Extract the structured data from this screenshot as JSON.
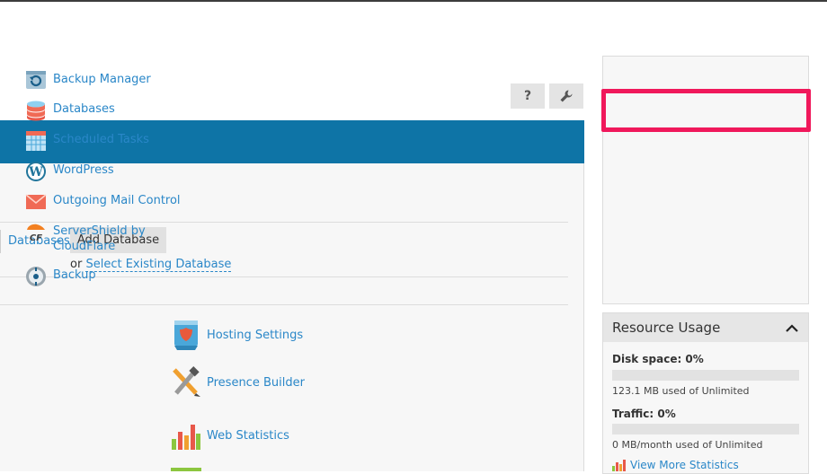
{
  "header": {
    "help_label": "?",
    "help_icon": "question-icon",
    "settings_icon": "wrench-icon"
  },
  "main": {
    "databases_link": "Databases",
    "add_database_button": "Add Database",
    "or_text": "or",
    "select_existing_link": "Select Existing Database",
    "tools": [
      {
        "label": "Hosting Settings",
        "icon": "hosting-settings-icon"
      },
      {
        "label": "Presence Builder",
        "icon": "presence-builder-icon"
      },
      {
        "label": "Web Statistics",
        "icon": "web-statistics-icon"
      }
    ]
  },
  "sidebar": {
    "items": [
      {
        "label": "Backup Manager",
        "icon": "backup-manager-icon"
      },
      {
        "label": "Databases",
        "icon": "databases-icon"
      },
      {
        "label": "Scheduled Tasks",
        "icon": "calendar-icon"
      },
      {
        "label": "WordPress",
        "icon": "wordpress-icon"
      },
      {
        "label": "Outgoing Mail Control",
        "icon": "mail-icon"
      },
      {
        "label": "ServerShield by CloudFlare",
        "icon": "cloudflare-icon"
      },
      {
        "label": "Backup",
        "icon": "backup-icon"
      }
    ],
    "highlight_color": "#f0185b"
  },
  "resource_usage": {
    "title": "Resource Usage",
    "disk_label": "Disk space: 0%",
    "disk_percent": 0,
    "disk_detail": "123.1 MB used of Unlimited",
    "traffic_label": "Traffic: 0%",
    "traffic_percent": 0,
    "traffic_detail": "0 MB/month used of Unlimited",
    "more_link": "View More Statistics"
  },
  "colors": {
    "accent_blue": "#0e74a6",
    "link": "#2a87c8"
  }
}
